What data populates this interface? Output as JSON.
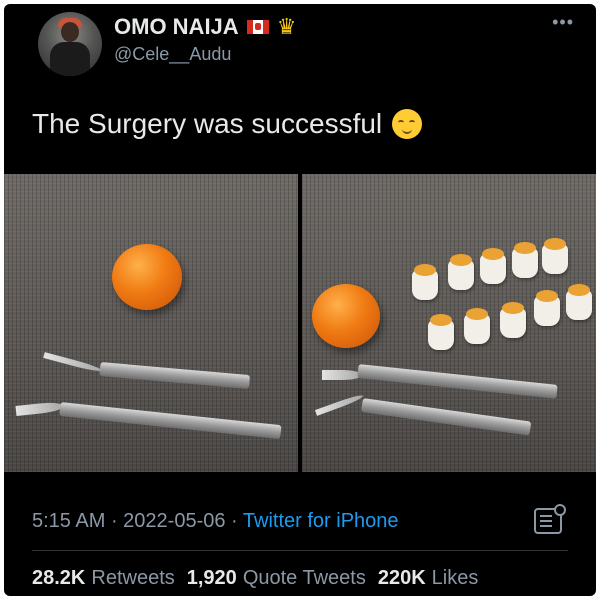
{
  "author": {
    "display_name": "OMO NAIJA",
    "handle": "@Cele__Audu",
    "badges": [
      "canada-flag-icon",
      "crown-icon"
    ]
  },
  "tweet": {
    "text": "The Surgery was successful",
    "emoji": "relieved-face-icon"
  },
  "meta": {
    "time": "5:15 AM",
    "separator": " · ",
    "date": "2022-05-06",
    "source": "Twitter for iPhone"
  },
  "stats": {
    "retweets_count": "28.2K",
    "retweets_label": "Retweets",
    "quotes_count": "1,920",
    "quotes_label": "Quote Tweets",
    "likes_count": "220K",
    "likes_label": "Likes"
  },
  "colors": {
    "background": "#000000",
    "text_primary": "#e7e9ea",
    "text_secondary": "#8b98a5",
    "link": "#1d9bf0"
  }
}
